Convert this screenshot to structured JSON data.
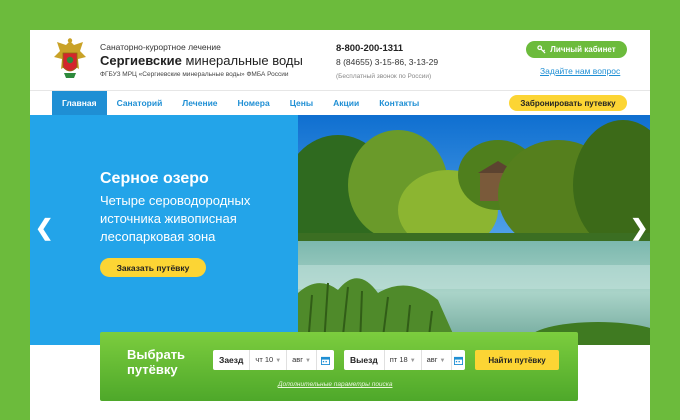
{
  "header": {
    "kicker": "Санаторно-курортное лечение",
    "name_bold": "Сергиевские",
    "name_rest": " минеральные воды",
    "org": "ФГБУЗ МРЦ «Сергиевские минеральные воды» ФМБА России",
    "phone_main": "8-800-200-1311",
    "phone_extra": "8 (84655) 3-15-86, 3-13-29",
    "phone_note": "(Бесплатный звонок по России)",
    "cabinet_label": "Личный кабинет",
    "ask_label": "Задайте нам вопрос"
  },
  "nav": {
    "items": [
      {
        "label": "Главная"
      },
      {
        "label": "Санаторий"
      },
      {
        "label": "Лечение"
      },
      {
        "label": "Номера"
      },
      {
        "label": "Цены"
      },
      {
        "label": "Акции"
      },
      {
        "label": "Контакты"
      }
    ],
    "active_index": 0,
    "book_label": "Забронировать путевку"
  },
  "hero": {
    "title": "Серное озеро",
    "text": "Четыре сероводородных источника живописная лесопарковая зона",
    "button_label": "Заказать путёвку"
  },
  "booking": {
    "title_line1": "Выбрать",
    "title_line2": "путёвку",
    "checkin_label": "Заезд",
    "checkin_day": "чт 10",
    "checkin_month": "авг",
    "checkout_label": "Выезд",
    "checkout_day": "пт 18",
    "checkout_month": "авг",
    "find_label": "Найти путёвку",
    "extra_link": "Дополнительные параметры поиска"
  },
  "colors": {
    "page_bg": "#6cbb3c",
    "accent_blue": "#1f8fd4",
    "hero_blue": "#23a4e9",
    "button_yellow": "#fcd534",
    "green": "#6cbb3c"
  },
  "icons": [
    "emblem-logo",
    "key-icon",
    "chevron-left-icon",
    "chevron-right-icon",
    "calendar-icon",
    "dropdown-icon"
  ]
}
